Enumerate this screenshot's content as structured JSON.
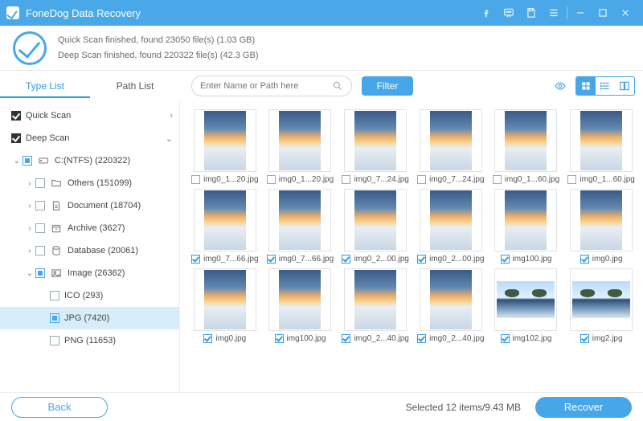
{
  "app": {
    "title": "FoneDog Data Recovery"
  },
  "status": {
    "line1": "Quick Scan finished, found 23050 file(s) (1.03 GB)",
    "line2": "Deep Scan finished, found 220322 file(s) (42.3 GB)"
  },
  "tabs": {
    "type_list": "Type List",
    "path_list": "Path List"
  },
  "search": {
    "placeholder": "Enter Name or Path here"
  },
  "filter_label": "Filter",
  "tree": {
    "quick_scan": "Quick Scan",
    "deep_scan": "Deep Scan",
    "drive": "C:(NTFS) (220322)",
    "others": "Others (151099)",
    "document": "Document (18704)",
    "archive": "Archive (3627)",
    "database": "Database (20061)",
    "image": "Image (26362)",
    "ico": "ICO (293)",
    "jpg": "JPG (7420)",
    "png": "PNG (11653)"
  },
  "thumbs": [
    {
      "name": "img0_1...20.jpg",
      "checked": false,
      "variant": "tall"
    },
    {
      "name": "img0_1...20.jpg",
      "checked": false,
      "variant": "tall"
    },
    {
      "name": "img0_7...24.jpg",
      "checked": false,
      "variant": "tall"
    },
    {
      "name": "img0_7...24.jpg",
      "checked": false,
      "variant": "tall"
    },
    {
      "name": "img0_1...60.jpg",
      "checked": false,
      "variant": "tall"
    },
    {
      "name": "img0_1...60.jpg",
      "checked": false,
      "variant": "tall"
    },
    {
      "name": "img0_7...66.jpg",
      "checked": true,
      "variant": "tall"
    },
    {
      "name": "img0_7...66.jpg",
      "checked": true,
      "variant": "tall"
    },
    {
      "name": "img0_2...00.jpg",
      "checked": true,
      "variant": "tall"
    },
    {
      "name": "img0_2...00.jpg",
      "checked": true,
      "variant": "tall"
    },
    {
      "name": "img100.jpg",
      "checked": true,
      "variant": "tall"
    },
    {
      "name": "img0.jpg",
      "checked": true,
      "variant": "tall"
    },
    {
      "name": "img0.jpg",
      "checked": true,
      "variant": "tall"
    },
    {
      "name": "img100.jpg",
      "checked": true,
      "variant": "tall"
    },
    {
      "name": "img0_2...40.jpg",
      "checked": true,
      "variant": "tall"
    },
    {
      "name": "img0_2...40.jpg",
      "checked": true,
      "variant": "tall"
    },
    {
      "name": "img102.jpg",
      "checked": true,
      "variant": "wide"
    },
    {
      "name": "img2.jpg",
      "checked": true,
      "variant": "wide"
    }
  ],
  "footer": {
    "back": "Back",
    "recover": "Recover",
    "selected": "Selected 12 items/9.43 MB"
  }
}
